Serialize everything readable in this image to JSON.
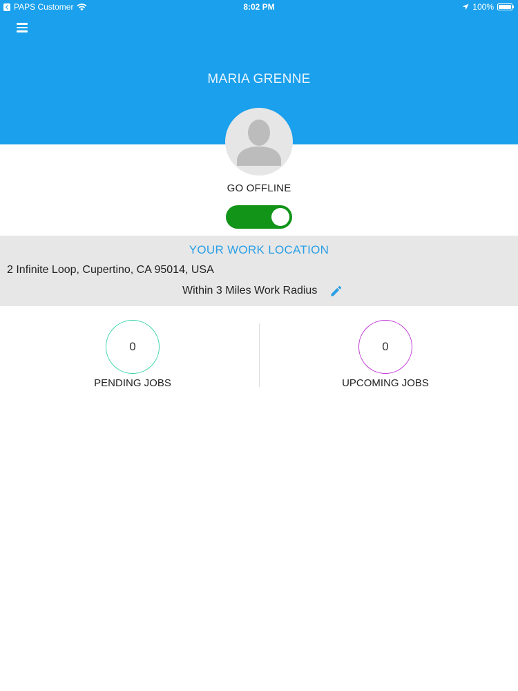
{
  "status_bar": {
    "carrier": "PAPS Customer",
    "time": "8:02 PM",
    "battery": "100%",
    "icons": [
      "back-arrow-icon",
      "wifi-icon",
      "location-arrow-icon",
      "battery-icon"
    ]
  },
  "header": {
    "menu_icon": "hamburger-menu-icon",
    "user_name": "MARIA GRENNE",
    "avatar_icon": "person-silhouette-icon"
  },
  "availability": {
    "label": "GO OFFLINE",
    "toggle_on": true
  },
  "work_location": {
    "title": "YOUR WORK LOCATION",
    "address": "2 Infinite Loop,  Cupertino,  CA 95014,  USA",
    "radius": "Within 3 Miles Work Radius",
    "edit_icon": "pencil-edit-icon"
  },
  "stats": {
    "pending": {
      "count": "0",
      "label": "PENDING JOBS"
    },
    "upcoming": {
      "count": "0",
      "label": "UPCOMING JOBS"
    }
  },
  "colors": {
    "header_bg": "#1aa0ec",
    "toggle_on": "#129419",
    "accent_title": "#2a9fe6",
    "pending_ring": "#3fd5ad",
    "upcoming_ring": "#c23ad8",
    "location_panel_bg": "#e7e7e7"
  }
}
